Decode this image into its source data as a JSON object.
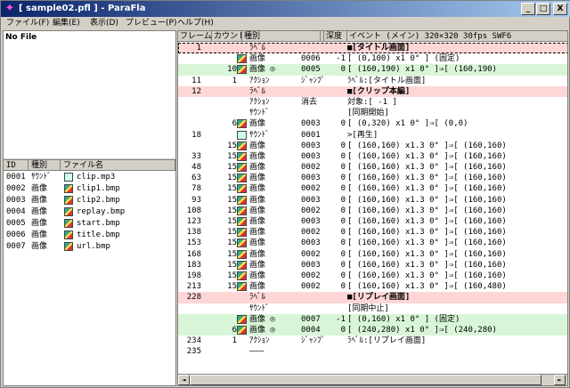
{
  "window": {
    "title": "[ sample02.pfl ] - ParaFla",
    "min_label": "_",
    "max_label": "□",
    "close_label": "X"
  },
  "menu": [
    "ファイル(F)",
    "編集(E)",
    "表示(D)",
    "プレビュー(P)",
    "ヘルプ(H)"
  ],
  "left": {
    "nofile": "No File",
    "columns": [
      "ID",
      "種別",
      "ファイル名"
    ],
    "files": [
      {
        "id": "0001",
        "kind": "ｻｳﾝﾄﾞ",
        "name": "clip.mp3",
        "icon": "sound-icon"
      },
      {
        "id": "0002",
        "kind": "画像",
        "name": "clip1.bmp",
        "icon": "image-icon"
      },
      {
        "id": "0003",
        "kind": "画像",
        "name": "clip2.bmp",
        "icon": "image-icon"
      },
      {
        "id": "0004",
        "kind": "画像",
        "name": "replay.bmp",
        "icon": "image-icon"
      },
      {
        "id": "0005",
        "kind": "画像",
        "name": "start.bmp",
        "icon": "image-icon"
      },
      {
        "id": "0006",
        "kind": "画像",
        "name": "title.bmp",
        "icon": "image-icon"
      },
      {
        "id": "0007",
        "kind": "画像",
        "name": "url.bmp",
        "icon": "image-icon"
      }
    ]
  },
  "table": {
    "columns": [
      "フレーム",
      "カウント",
      "種別",
      "",
      "深度",
      "イベント (メイン)  320×320  30fps  SWF6"
    ],
    "rows": [
      {
        "style": "pink sel",
        "frame": "1",
        "count": "",
        "icon": "",
        "kind": "ﾗﾍﾞﾙ",
        "name": "",
        "depth": "",
        "event": "■[タイトル画面]",
        "bold": true
      },
      {
        "style": "",
        "frame": "",
        "count": "",
        "icon": "image",
        "kind": "画像",
        "name": "0006",
        "depth": "-1",
        "event": "[     (0,100)              x1     0° ] (固定)"
      },
      {
        "style": "green",
        "frame": "",
        "count": "10",
        "icon": "image",
        "kind": "画像 ◎",
        "name": "0005",
        "depth": "0",
        "event": "[     (160,190)            x1     0° ]⇒[    (160,190)"
      },
      {
        "style": "",
        "frame": "11",
        "count": "1",
        "icon": "",
        "kind": "ｱｸｼｮﾝ",
        "name": "ｼﾞｬﾝﾌﾟ",
        "depth": "",
        "event": "ﾗﾍﾞﾙ:[タイトル画面]"
      },
      {
        "style": "pink",
        "frame": "12",
        "count": "",
        "icon": "",
        "kind": "ﾗﾍﾞﾙ",
        "name": "",
        "depth": "",
        "event": "■[クリップ本編]",
        "bold": true
      },
      {
        "style": "",
        "frame": "",
        "count": "",
        "icon": "",
        "kind": "ｱｸｼｮﾝ",
        "name": "消去",
        "depth": "",
        "event": "対象:[ -1 ]"
      },
      {
        "style": "",
        "frame": "",
        "count": "",
        "icon": "",
        "kind": "ｻｳﾝﾄﾞ",
        "name": "",
        "depth": "",
        "event": "[同期開始]"
      },
      {
        "style": "",
        "frame": "",
        "count": "6",
        "icon": "image",
        "kind": "画像",
        "name": "0003",
        "depth": "0",
        "event": "[     (0,320)              x1     0° ]⇒[        (0,0)"
      },
      {
        "style": "",
        "frame": "18",
        "count": "",
        "icon": "sound",
        "kind": "ｻｳﾝﾄﾞ",
        "name": "0001",
        "depth": "",
        "event": ">[再生]"
      },
      {
        "style": "",
        "frame": "",
        "count": "15",
        "icon": "image",
        "kind": "画像",
        "name": "0003",
        "depth": "0",
        "event": "[     (160,160)          x1.3     0° ]⇒[    (160,160)"
      },
      {
        "style": "",
        "frame": "33",
        "count": "15",
        "icon": "image",
        "kind": "画像",
        "name": "0003",
        "depth": "0",
        "event": "[     (160,160)          x1.3     0° ]⇒[    (160,160)"
      },
      {
        "style": "",
        "frame": "48",
        "count": "15",
        "icon": "image",
        "kind": "画像",
        "name": "0002",
        "depth": "0",
        "event": "[     (160,160)          x1.3     0° ]⇒[    (160,160)"
      },
      {
        "style": "",
        "frame": "63",
        "count": "15",
        "icon": "image",
        "kind": "画像",
        "name": "0003",
        "depth": "0",
        "event": "[     (160,160)          x1.3     0° ]⇒[    (160,160)"
      },
      {
        "style": "",
        "frame": "78",
        "count": "15",
        "icon": "image",
        "kind": "画像",
        "name": "0002",
        "depth": "0",
        "event": "[     (160,160)          x1.3     0° ]⇒[    (160,160)"
      },
      {
        "style": "",
        "frame": "93",
        "count": "15",
        "icon": "image",
        "kind": "画像",
        "name": "0003",
        "depth": "0",
        "event": "[     (160,160)          x1.3     0° ]⇒[    (160,160)"
      },
      {
        "style": "",
        "frame": "108",
        "count": "15",
        "icon": "image",
        "kind": "画像",
        "name": "0002",
        "depth": "0",
        "event": "[     (160,160)          x1.3     0° ]⇒[    (160,160)"
      },
      {
        "style": "",
        "frame": "123",
        "count": "15",
        "icon": "image",
        "kind": "画像",
        "name": "0003",
        "depth": "0",
        "event": "[     (160,160)          x1.3     0° ]⇒[    (160,160)"
      },
      {
        "style": "",
        "frame": "138",
        "count": "15",
        "icon": "image",
        "kind": "画像",
        "name": "0002",
        "depth": "0",
        "event": "[     (160,160)          x1.3     0° ]⇒[    (160,160)"
      },
      {
        "style": "",
        "frame": "153",
        "count": "15",
        "icon": "image",
        "kind": "画像",
        "name": "0003",
        "depth": "0",
        "event": "[     (160,160)          x1.3     0° ]⇒[    (160,160)"
      },
      {
        "style": "",
        "frame": "168",
        "count": "15",
        "icon": "image",
        "kind": "画像",
        "name": "0002",
        "depth": "0",
        "event": "[     (160,160)          x1.3     0° ]⇒[    (160,160)"
      },
      {
        "style": "",
        "frame": "183",
        "count": "15",
        "icon": "image",
        "kind": "画像",
        "name": "0003",
        "depth": "0",
        "event": "[     (160,160)          x1.3     0° ]⇒[    (160,160)"
      },
      {
        "style": "",
        "frame": "198",
        "count": "15",
        "icon": "image",
        "kind": "画像",
        "name": "0002",
        "depth": "0",
        "event": "[     (160,160)          x1.3     0° ]⇒[    (160,160)"
      },
      {
        "style": "",
        "frame": "213",
        "count": "15",
        "icon": "image",
        "kind": "画像",
        "name": "0002",
        "depth": "0",
        "event": "[     (160,160)          x1.3     0° ]⇒[    (160,480)"
      },
      {
        "style": "pink",
        "frame": "228",
        "count": "",
        "icon": "",
        "kind": "ﾗﾍﾞﾙ",
        "name": "",
        "depth": "",
        "event": "■[リプレイ画面]",
        "bold": true
      },
      {
        "style": "",
        "frame": "",
        "count": "",
        "icon": "",
        "kind": "ｻｳﾝﾄﾞ",
        "name": "",
        "depth": "",
        "event": "[同期中止]"
      },
      {
        "style": "green",
        "frame": "",
        "count": "",
        "icon": "image",
        "kind": "画像 ◎",
        "name": "0007",
        "depth": "-1",
        "event": "[     (0,160)              x1     0° ] (固定)"
      },
      {
        "style": "green",
        "frame": "",
        "count": "6",
        "icon": "image",
        "kind": "画像 ◎",
        "name": "0004",
        "depth": "0",
        "event": "[     (240,280)            x1     0° ]⇒[    (240,280)"
      },
      {
        "style": "",
        "frame": "234",
        "count": "1",
        "icon": "",
        "kind": "ｱｸｼｮﾝ",
        "name": "ｼﾞｬﾝﾌﾟ",
        "depth": "",
        "event": "ﾗﾍﾞﾙ:[リプレイ画面]"
      },
      {
        "style": "",
        "frame": "235",
        "count": "",
        "icon": "",
        "kind": "———",
        "name": "",
        "depth": "",
        "event": ""
      }
    ]
  },
  "scroll": {
    "left_arrow": "◄",
    "right_arrow": "►"
  }
}
